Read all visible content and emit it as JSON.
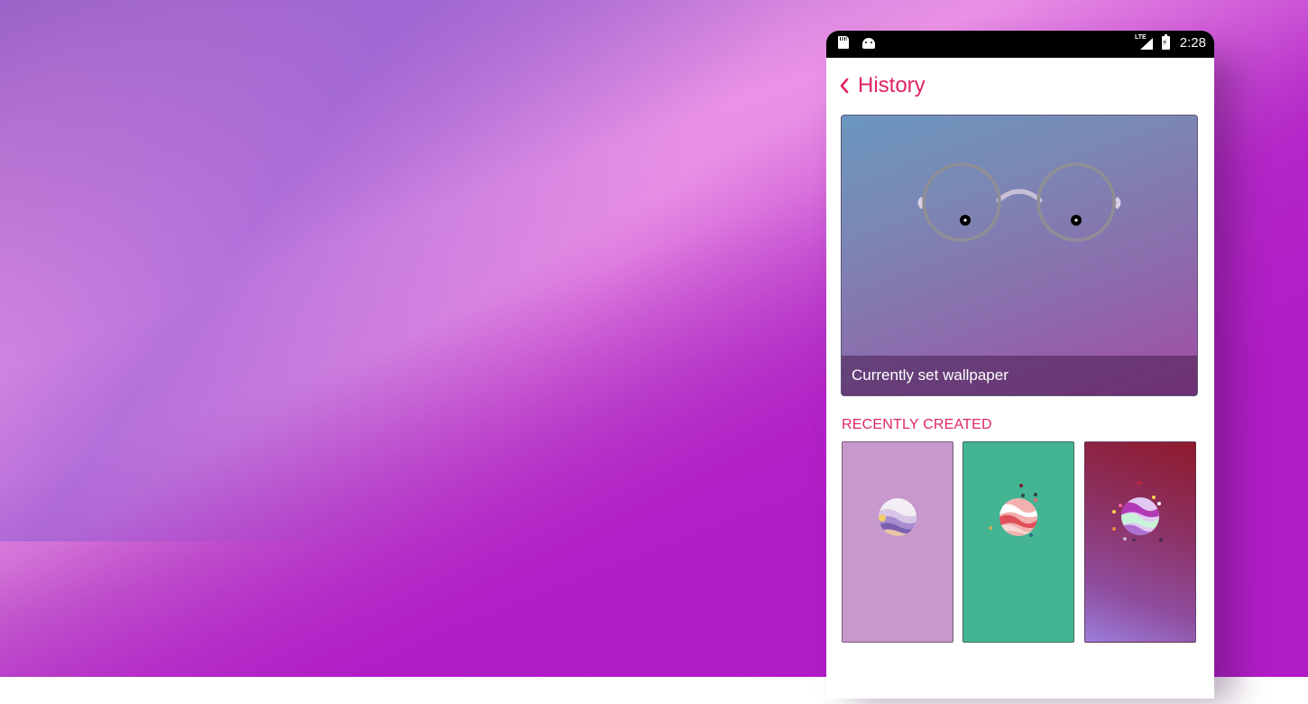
{
  "status_bar": {
    "network": "LTE",
    "time": "2:28",
    "icons": [
      "sd-card-icon",
      "android-icon",
      "signal-icon",
      "battery-charging-icon"
    ]
  },
  "header": {
    "back_icon": "chevron-left-icon",
    "title": "History"
  },
  "current_wallpaper": {
    "caption": "Currently set wallpaper"
  },
  "recent": {
    "section_title": "RECENTLY CREATED",
    "items": [
      {
        "background": "#c798cc"
      },
      {
        "background": "#43b593"
      },
      {
        "background": "#8e1a2c"
      }
    ]
  },
  "colors": {
    "accent": "#e0255f",
    "status_bar": "#000000"
  }
}
